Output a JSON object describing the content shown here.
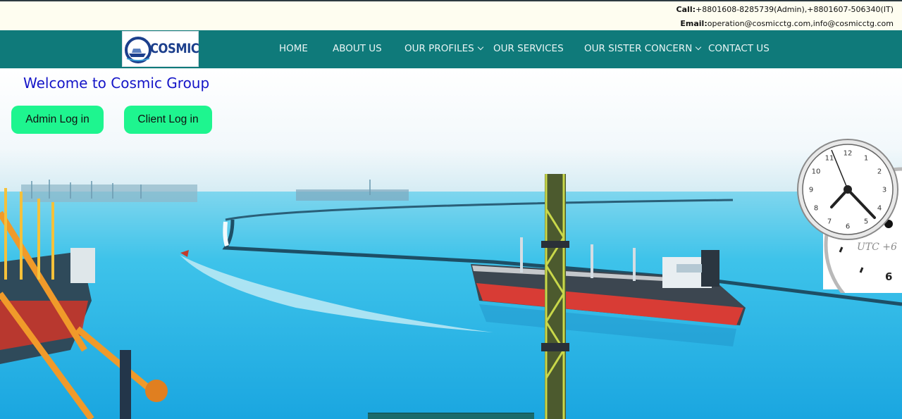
{
  "topbar": {
    "call_label": "Call:",
    "call_value": "+8801608-8285739(Admin),+8801607-506340(IT)",
    "email_label": "Email:",
    "email_value": "operation@cosmicctg.com,info@cosmicctg.com"
  },
  "logo": {
    "text": "COSMIC"
  },
  "nav": {
    "home": "HOME",
    "about": "ABOUT US",
    "profiles": "OUR PROFILES",
    "services": "OUR SERVICES",
    "sister": "OUR SISTER CONCERN",
    "contact": "CONTACT US"
  },
  "hero": {
    "welcome": "Welcome to Cosmic Group",
    "admin_button": "Admin Log in",
    "client_button": "Client Log in"
  },
  "clock": {
    "numbers": [
      "12",
      "1",
      "2",
      "3",
      "4",
      "5",
      "6",
      "7",
      "8",
      "9",
      "10",
      "11"
    ],
    "timezone": "UTC +6",
    "second_clock_number": "6"
  },
  "colors": {
    "nav_bg": "#0f7a7a",
    "button_bg": "#1ef58f",
    "welcome_text": "#1515c8",
    "topbar_bg": "#fefdf0"
  }
}
